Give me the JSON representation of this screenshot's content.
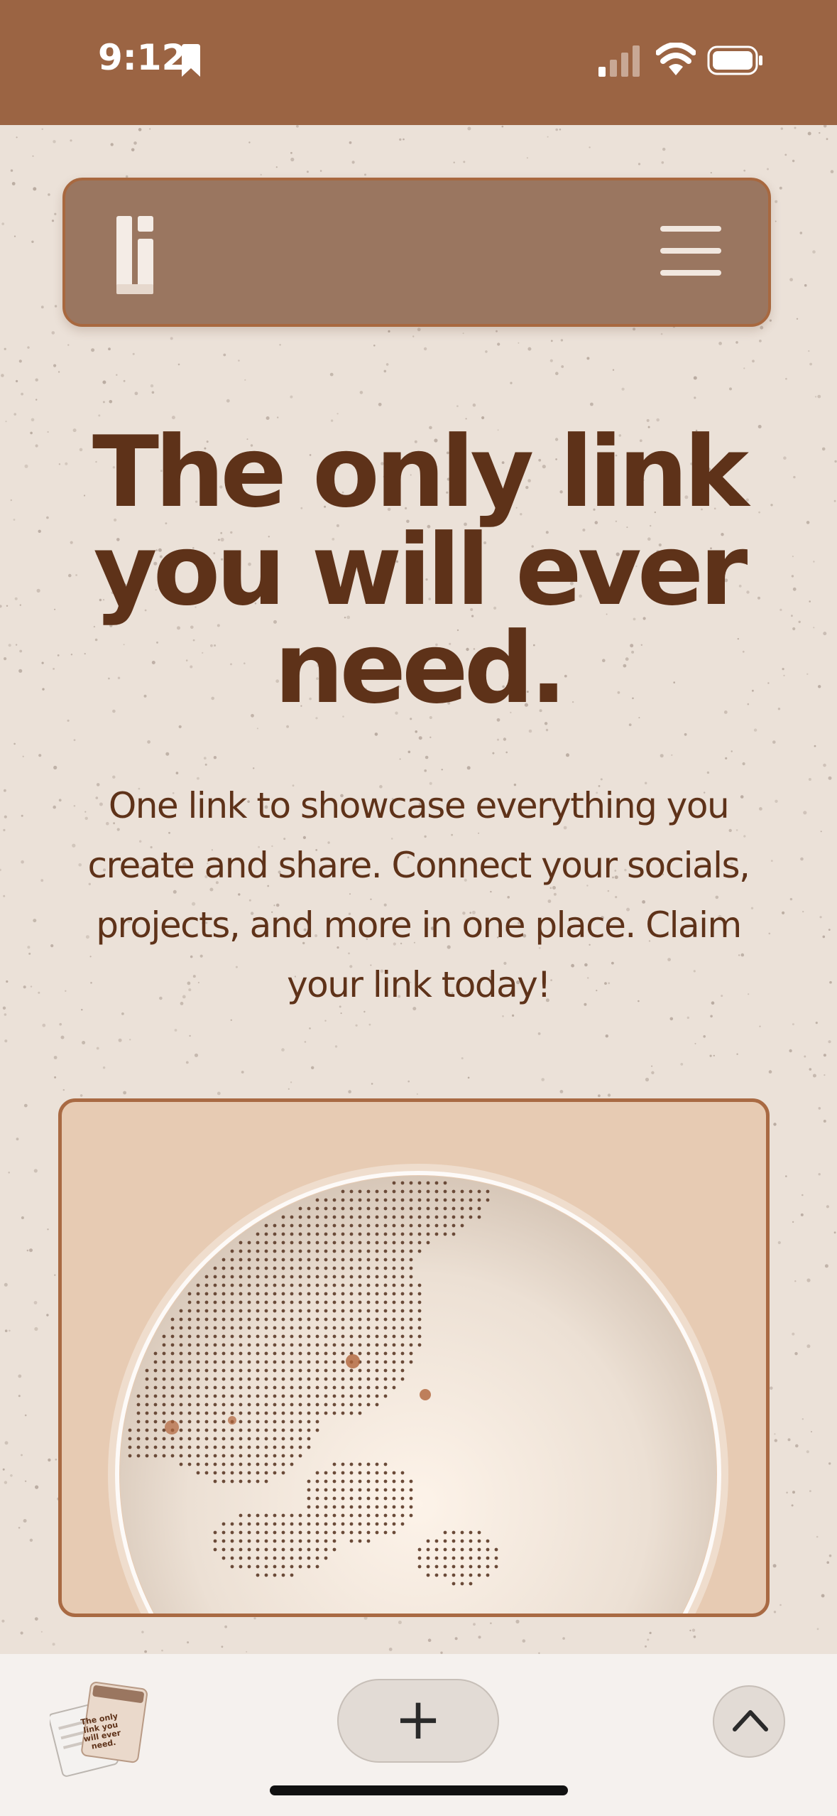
{
  "status_bar": {
    "time": "9:12",
    "icons": [
      "bookmark-icon",
      "cellular-signal-icon",
      "wifi-icon",
      "battery-icon"
    ]
  },
  "navbar": {
    "logo": "li-logo",
    "menu_icon": "hamburger-menu-icon"
  },
  "hero": {
    "title": "The only link you will ever need.",
    "subtitle": "One link to showcase everything you create and share. Connect your socials, projects, and more in one place. Claim your link today!"
  },
  "globe_card": {
    "image": "dotted-globe-illustration"
  },
  "browser_bar": {
    "tab_preview_text": "The only link you will ever need.",
    "new_tab_label": "+",
    "scroll_top_icon": "chevron-up-icon"
  },
  "colors": {
    "status_bar": "#9b6443",
    "background": "#ebe1d8",
    "navbar": "#9a7660",
    "heading": "#5e3219",
    "card": "#e7cbb3",
    "accent_border": "#a8683f"
  }
}
